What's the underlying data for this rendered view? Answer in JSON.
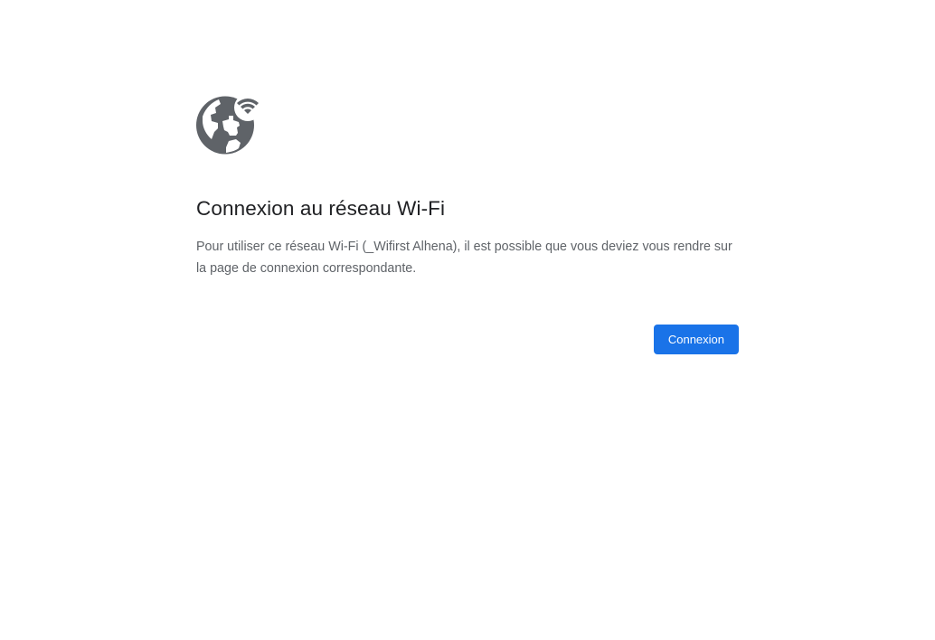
{
  "icon": {
    "name": "globe-wifi-icon",
    "color": "#5f6368"
  },
  "main": {
    "title": "Connexion au réseau Wi-Fi",
    "description": "Pour utiliser ce réseau Wi-Fi (_Wifirst Alhena), il est possible que vous deviez vous rendre sur la page de connexion correspondante."
  },
  "actions": {
    "connect_label": "Connexion"
  },
  "colors": {
    "accent": "#1a73e8",
    "title_text": "#202124",
    "body_text": "#5f6368",
    "background": "#ffffff"
  }
}
